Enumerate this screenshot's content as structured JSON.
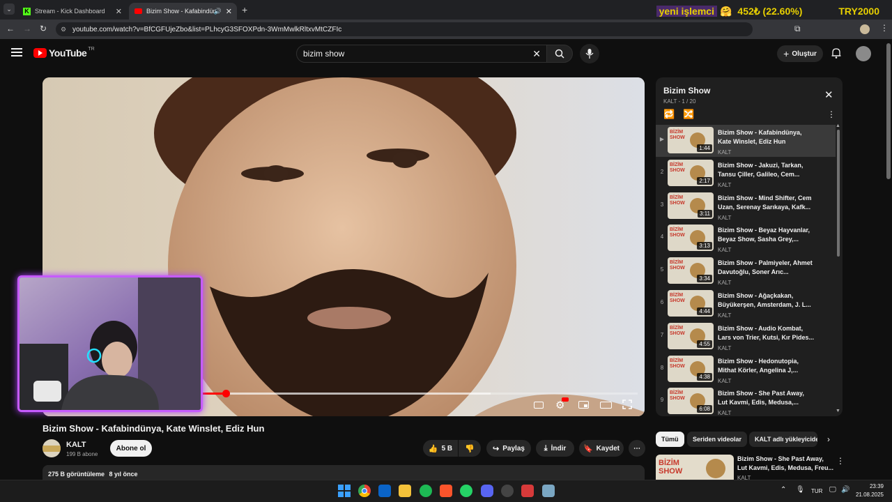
{
  "browser": {
    "tabs": [
      {
        "label": "Stream - Kick Dashboard"
      },
      {
        "label": "Bizim Show - Kafabindünya"
      }
    ],
    "url": "youtube.com/watch?v=BfCGFUjeZbo&list=PLhcyG3SFOXPdn-3WmMwlkRltxvMtCZFIc"
  },
  "ticker": {
    "name": "yeni işlemci",
    "change": "452₺ (22.60%)",
    "price": "TRY2000"
  },
  "youtube": {
    "logo_text": "YouTube",
    "region": "TR",
    "search_value": "bizim show",
    "create_label": "Oluştur"
  },
  "video": {
    "title": "Bizim Show - Kafabindünya, Kate Winslet, Ediz Hun",
    "channel": "KALT",
    "subscribers": "199 B abone",
    "subscribe_label": "Abone ol",
    "likes": "5 B",
    "share_label": "Paylaş",
    "download_label": "İndir",
    "save_label": "Kaydet",
    "views": "275 B görüntüleme",
    "age": "8 yıl önce",
    "progress": 0.3,
    "buffered": 0.75
  },
  "playlist": {
    "title": "Bizim Show",
    "subtitle": "KALT - 1 / 20",
    "items": [
      {
        "index": "▶",
        "title": "Bizim Show - Kafabindünya, Kate Winslet, Ediz Hun",
        "channel": "KALT",
        "duration": "1:44"
      },
      {
        "index": "2",
        "title": "Bizim Show - Jakuzi, Tarkan, Tansu Çiller, Galileo, Cem...",
        "channel": "KALT",
        "duration": "2:17"
      },
      {
        "index": "3",
        "title": "Bizim Show - Mind Shifter, Cem Uzan, Serenay Sarıkaya, Kafk...",
        "channel": "KALT",
        "duration": "3:11"
      },
      {
        "index": "4",
        "title": "Bizim Show - Beyaz Hayvanlar, Beyaz Show, Sasha Grey,...",
        "channel": "KALT",
        "duration": "3:13"
      },
      {
        "index": "5",
        "title": "Bizim Show - Palmiyeler, Ahmet Davutoğlu, Soner Arıc...",
        "channel": "KALT",
        "duration": "3:34"
      },
      {
        "index": "6",
        "title": "Bizim Show - Ağaçkakan, Büyükerşen, Amsterdam, J. L...",
        "channel": "KALT",
        "duration": "4:44"
      },
      {
        "index": "7",
        "title": "Bizim Show - Audio Kombat, Lars von Trier, Kutsi, Kır Pides...",
        "channel": "KALT",
        "duration": "4:55"
      },
      {
        "index": "8",
        "title": "Bizim Show - Hedonutopia, Mithat Körler, Angelina J,...",
        "channel": "KALT",
        "duration": "4:38"
      },
      {
        "index": "9",
        "title": "Bizim Show - She Past Away, Lut Kavmi, Edis, Medusa,...",
        "channel": "KALT",
        "duration": "6:08"
      }
    ]
  },
  "chips": [
    "Tümü",
    "Seriden videolar",
    "KALT adlı yükleyiciden"
  ],
  "recommendation": {
    "title": "Bizim Show - She Past Away, Lut Kavmi, Edis, Medusa, Freu...",
    "channel": "KALT",
    "thumb_text": "BİZİM SHOW"
  },
  "thumb_text": "BİZİM SHOW",
  "taskbar": {
    "lang": "TUR",
    "time": "23:39",
    "date": "21.08.2025"
  }
}
